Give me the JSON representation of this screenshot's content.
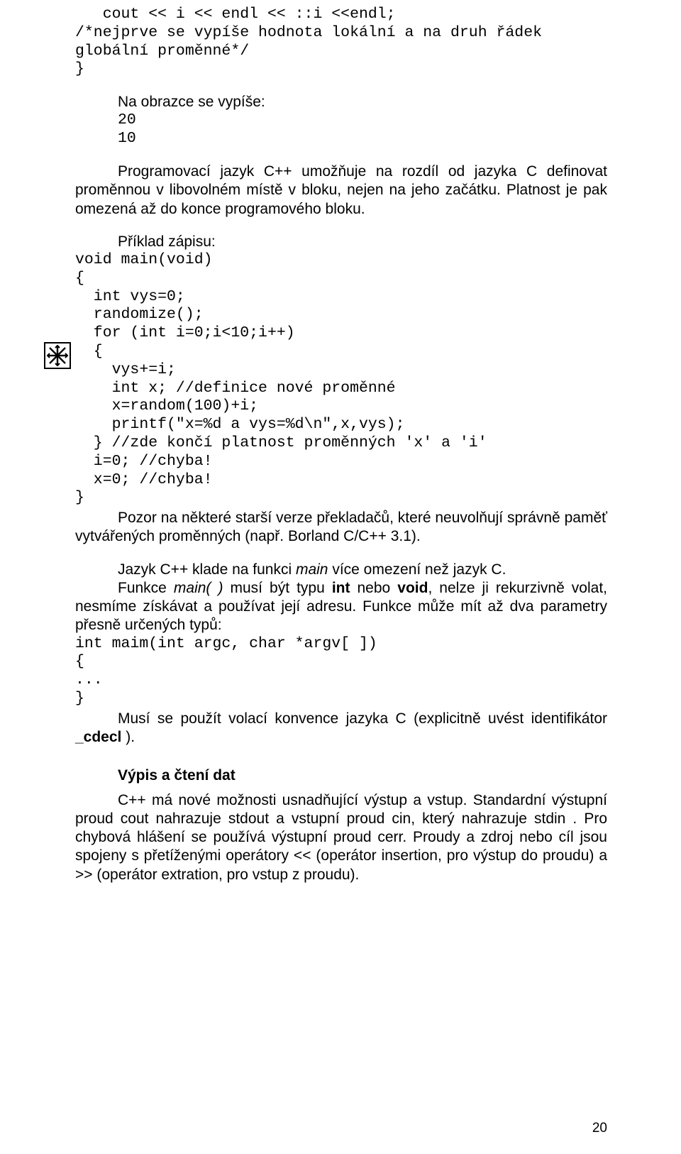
{
  "code_top": {
    "l1": "   cout << i << endl << ::i <<endl;",
    "l2": "/*nejprve se vypíše hodnota lokální a na druh řádek",
    "l3": "globální proměnné*/",
    "l4": "}"
  },
  "screen_output": {
    "heading": "Na obrazce se vypíše:",
    "l1": "20",
    "l2": "10"
  },
  "para1": "Programovací jazyk C++ umožňuje na rozdíl od jazyka C definovat proměnnou v libovolném místě v bloku, nejen na jeho začátku. Platnost je pak omezená až do konce programového bloku.",
  "example2": {
    "heading": "Příklad zápisu:",
    "l1": "void main(void)",
    "l2": "{",
    "l3": "  int vys=0;",
    "l4": "  randomize();",
    "l5": "  for (int i=0;i<10;i++)",
    "l6": "  {",
    "l7": "    vys+=i;",
    "l8": "    int x; //definice nové proměnné",
    "l9": "    x=random(100)+i;",
    "l10": "    printf(\"x=%d a vys=%d\\n\",x,vys);",
    "l11": "  } //zde končí platnost proměnných 'x' a 'i'",
    "l12": "  i=0; //chyba!",
    "l13": "  x=0; //chyba!",
    "l14": "}"
  },
  "para2": "Pozor na některé starší verze překladačů, které neuvolňují správně paměť vytvářených proměnných (např. Borland C/C++ 3.1).",
  "para3_l1_prefix": "Jazyk C++ klade na funkci ",
  "para3_l1_italic": "main",
  "para3_l1_suffix": " více omezení než jazyk C.",
  "para3_l2_a": "Funkce ",
  "para3_l2_b": "main( )",
  "para3_l2_c": " musí být typu ",
  "para3_l2_d": "int",
  "para3_l2_e": " nebo ",
  "para3_l2_f": "void",
  "para3_l2_g": ", nelze ji rekurzivně volat, nesmíme získávat a používat její adresu. Funkce může mít až dva parametry přesně určených typů:",
  "code_main": {
    "l1": "int maim(int argc, char *argv[ ])",
    "l2": "{",
    "l3": "...",
    "l4": "}"
  },
  "para4_a": "Musí se použít volací konvence jazyka C (explicitně uvést identifikátor ",
  "para4_b": "_cdecl",
  "para4_c": " ).",
  "heading2": "Výpis a čtení dat",
  "para5": "C++ má nové možnosti usnadňující výstup a vstup. Standardní výstupní proud cout  nahrazuje stdout a vstupní proud cin, který nahrazuje stdin . Pro chybová hlášení se používá výstupní proud cerr. Proudy a zdroj nebo cíl jsou spojeny s přetíženými operátory << (operátor insertion, pro výstup do proudu) a >> (operátor extration, pro vstup z proudu).",
  "page_number": "20",
  "icon_name": "example-icon"
}
